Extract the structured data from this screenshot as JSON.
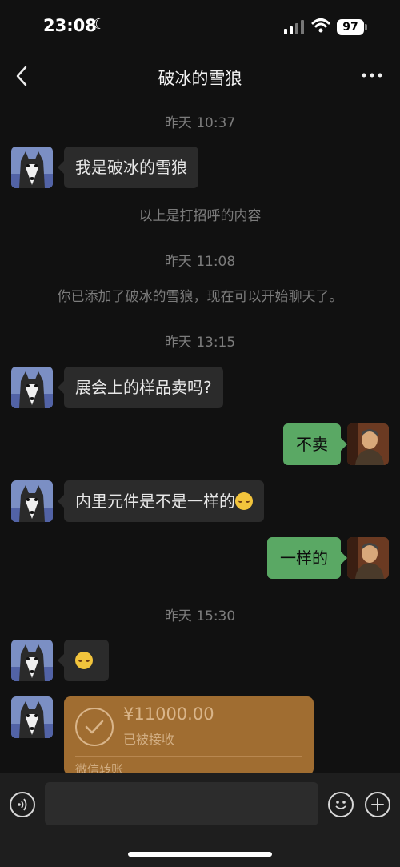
{
  "status_bar": {
    "time": "23:08",
    "battery": "97"
  },
  "header": {
    "title": "破冰的雪狼"
  },
  "messages": {
    "ts1": "昨天 10:37",
    "m1": "我是破冰的雪狼",
    "sys1": "以上是打招呼的内容",
    "ts2": "昨天 11:08",
    "sys2": "你已添加了破冰的雪狼，现在可以开始聊天了。",
    "ts3": "昨天 13:15",
    "m2": "展会上的样品卖吗?",
    "m3": "不卖",
    "m4": "内里元件是不是一样的",
    "m5": "一样的",
    "ts4": "昨天 15:30"
  },
  "transfer": {
    "amount": "¥11000.00",
    "status": "已被接收",
    "label": "微信转账"
  },
  "colors": {
    "outgoing_bubble": "#5aa864",
    "incoming_bubble": "#2b2b2b",
    "transfer_card": "#a06d31"
  },
  "icons": [
    "moon-icon",
    "signal-icon",
    "wifi-icon",
    "back-icon",
    "more-icon",
    "voice-icon",
    "emoji-icon",
    "plus-icon",
    "check-icon"
  ]
}
